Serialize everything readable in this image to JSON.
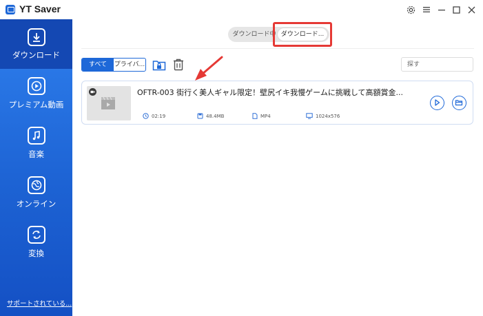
{
  "app": {
    "title": "YT Saver"
  },
  "window_controls": {
    "settings_icon": "gear-icon",
    "menu_icon": "hamburger-icon",
    "minimize_icon": "minimize-icon",
    "maximize_icon": "maximize-icon",
    "close_icon": "close-icon"
  },
  "sidebar": {
    "items": [
      {
        "label": "ダウンロード",
        "icon": "download-icon",
        "active": true
      },
      {
        "label": "プレミアム動画",
        "icon": "play-icon",
        "active": false
      },
      {
        "label": "音楽",
        "icon": "music-icon",
        "active": false
      },
      {
        "label": "オンライン",
        "icon": "globe-icon",
        "active": false
      },
      {
        "label": "変換",
        "icon": "convert-icon",
        "active": false
      }
    ],
    "support_link": "サポートされている..."
  },
  "tabs": {
    "downloading": "ダウンロード中",
    "downloaded": "ダウンロード..."
  },
  "filter": {
    "all": "すべて",
    "private": "プライバ..."
  },
  "search": {
    "placeholder": "探す"
  },
  "video": {
    "title": "OFTR-003 街行く美人ギャル限定！壁尻イキ我慢ゲームに挑戦して高額賞金...",
    "duration": "02:19",
    "size": "48.4MB",
    "format": "MP4",
    "resolution": "1024x576"
  },
  "colors": {
    "accent": "#1e68d8",
    "annotation": "#e53935"
  }
}
